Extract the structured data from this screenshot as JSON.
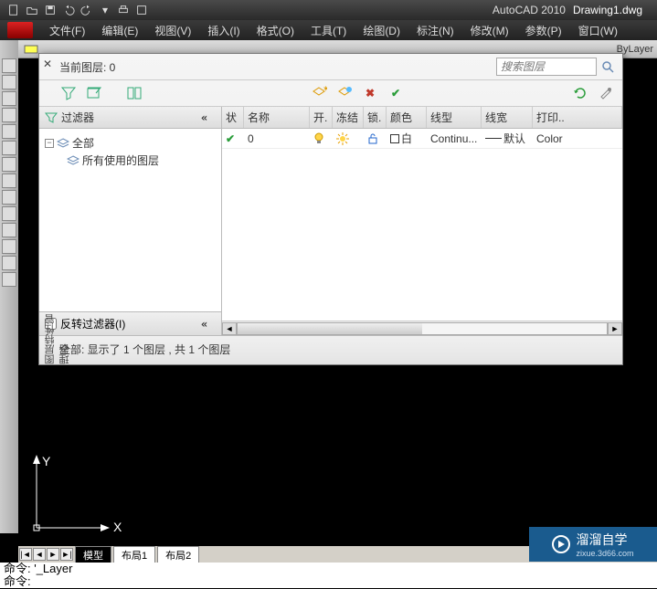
{
  "titlebar": {
    "app": "AutoCAD 2010",
    "doc": "Drawing1.dwg"
  },
  "menubar": {
    "items": [
      "文件(F)",
      "编辑(E)",
      "视图(V)",
      "插入(I)",
      "格式(O)",
      "工具(T)",
      "绘图(D)",
      "标注(N)",
      "修改(M)",
      "参数(P)",
      "窗口(W)"
    ]
  },
  "ribbon": {
    "bylayer": "ByLayer"
  },
  "ucs": {
    "x": "X",
    "y": "Y"
  },
  "layer_dialog": {
    "side_label": "图层特性管理器",
    "current_layer_label": "当前图层: 0",
    "search_placeholder": "搜索图层",
    "filter_header": "过滤器",
    "tree": {
      "root": "全部",
      "child": "所有使用的图层"
    },
    "invert_filter_label": "反转过滤器(I)",
    "columns": {
      "status": "状",
      "name": "名称",
      "on": "开.",
      "freeze": "冻结",
      "lock": "锁.",
      "color": "颜色",
      "ltype": "线型",
      "lweight": "线宽",
      "plot": "打印.."
    },
    "rows": [
      {
        "name": "0",
        "color": "白",
        "ltype": "Continu...",
        "lweight": "默认",
        "plot": "Color"
      }
    ],
    "status_text": "全部: 显示了 1 个图层 , 共 1 个图层"
  },
  "tabs": {
    "model": "模型",
    "layout1": "布局1",
    "layout2": "布局2"
  },
  "command": {
    "line1": "命令:  '_Layer",
    "line2": "命令:"
  },
  "badge": {
    "main": "溜溜自学",
    "sub": "zixue.3d66.com"
  }
}
